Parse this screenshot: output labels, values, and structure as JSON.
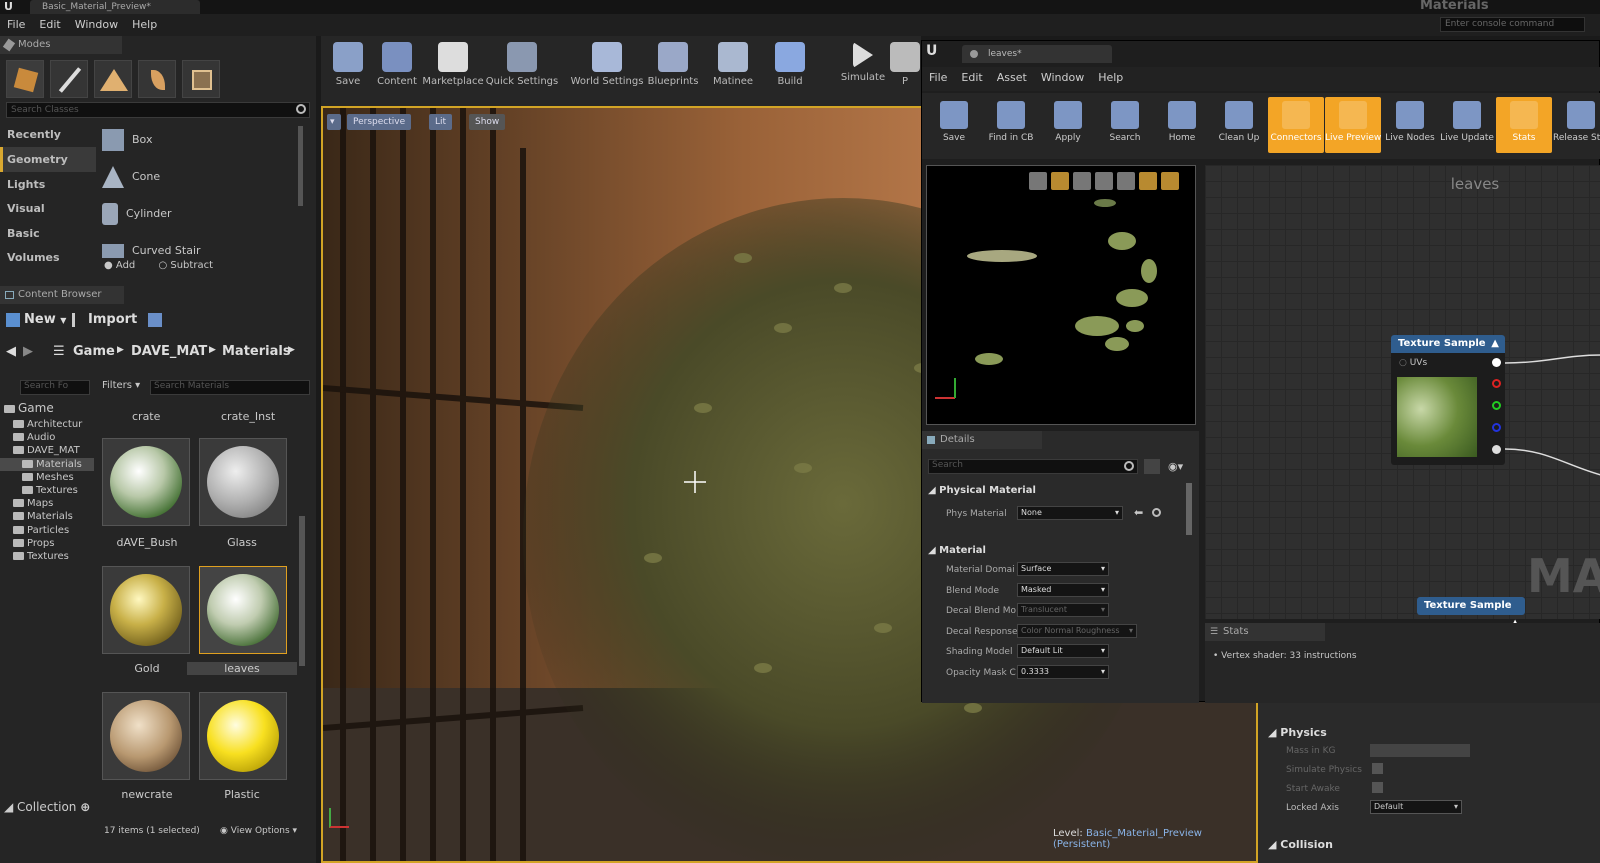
{
  "window": {
    "tab_title": "Basic_Material_Preview*",
    "app_title": "Materials",
    "console_placeholder": "Enter console command"
  },
  "menu": [
    "File",
    "Edit",
    "Window",
    "Help"
  ],
  "modes": {
    "tab": "Modes",
    "search_placeholder": "Search Classes",
    "categories": [
      "Recently Placed",
      "Geometry",
      "Lights",
      "Visual",
      "Basic",
      "Volumes"
    ],
    "shapes": [
      "Box",
      "Cone",
      "Cylinder",
      "Curved Stair"
    ],
    "brush": {
      "add": "Add",
      "subtract": "Subtract"
    }
  },
  "content_browser": {
    "tab": "Content Browser",
    "new_label": "New",
    "import_label": "Import",
    "breadcrumb": [
      "Game",
      "DAVE_MAT",
      "Materials"
    ],
    "folder_search_placeholder": "Search Fo",
    "filters_label": "Filters",
    "asset_search_placeholder": "Search Materials",
    "tree": [
      {
        "label": "Game",
        "level": 0
      },
      {
        "label": "Architectur",
        "level": 1
      },
      {
        "label": "Audio",
        "level": 1
      },
      {
        "label": "DAVE_MAT",
        "level": 1
      },
      {
        "label": "Materials",
        "level": 2
      },
      {
        "label": "Meshes",
        "level": 2
      },
      {
        "label": "Textures",
        "level": 2
      },
      {
        "label": "Maps",
        "level": 1
      },
      {
        "label": "Materials",
        "level": 1
      },
      {
        "label": "Particles",
        "level": 1
      },
      {
        "label": "Props",
        "level": 1
      },
      {
        "label": "Textures",
        "level": 1
      }
    ],
    "top_labels": [
      "crate",
      "crate_Inst"
    ],
    "assets": [
      "dAVE_Bush",
      "Glass",
      "Gold",
      "leaves",
      "newcrate",
      "Plastic"
    ],
    "collections_label": "Collection",
    "status": "17 items (1 selected)",
    "view_options": "View Options"
  },
  "toolbar": [
    "Save",
    "Content",
    "Marketplace",
    "Quick Settings",
    "World Settings",
    "Blueprints",
    "Matinee",
    "Build",
    "Simulate",
    "P"
  ],
  "viewport": {
    "perspective": "Perspective",
    "lit": "Lit",
    "show": "Show",
    "level_label": "Level:",
    "level_name": "Basic_Material_Preview (Persistent)"
  },
  "material_editor": {
    "tab": "leaves*",
    "menu": [
      "File",
      "Edit",
      "Asset",
      "Window",
      "Help"
    ],
    "toolbar": [
      {
        "label": "Save",
        "hl": false
      },
      {
        "label": "Find in CB",
        "hl": false
      },
      {
        "label": "Apply",
        "hl": false
      },
      {
        "label": "Search",
        "hl": false
      },
      {
        "label": "Home",
        "hl": false
      },
      {
        "label": "Clean Up",
        "hl": false
      },
      {
        "label": "Connectors",
        "hl": true
      },
      {
        "label": "Live Preview",
        "hl": true
      },
      {
        "label": "Live Nodes",
        "hl": false
      },
      {
        "label": "Live Update",
        "hl": false
      },
      {
        "label": "Stats",
        "hl": true
      },
      {
        "label": "Release Stats",
        "hl": false
      }
    ],
    "details": {
      "tab": "Details",
      "search_placeholder": "Search",
      "physical_section": "Physical Material",
      "phys_material_label": "Phys Material",
      "phys_material_value": "None",
      "material_section": "Material",
      "rows": [
        {
          "label": "Material Domai",
          "value": "Surface",
          "disabled": false
        },
        {
          "label": "Blend Mode",
          "value": "Masked",
          "disabled": false
        },
        {
          "label": "Decal Blend Mo",
          "value": "Translucent",
          "disabled": true
        },
        {
          "label": "Decal Response",
          "value": "Color Normal Roughness",
          "disabled": true
        },
        {
          "label": "Shading Model",
          "value": "Default Lit",
          "disabled": false
        },
        {
          "label": "Opacity Mask C",
          "value": "0.3333",
          "disabled": false
        }
      ]
    },
    "graph": {
      "title": "leaves",
      "node1": "Texture Sample",
      "node1_pin": "UVs",
      "node2": "Texture Sample",
      "watermark": "MAT"
    },
    "stats": {
      "tab": "Stats",
      "line": "Vertex shader: 33 instructions"
    }
  },
  "right_details": {
    "physics_section": "Physics",
    "rows": [
      "Mass in KG",
      "Simulate Physics",
      "Start Awake",
      "Locked Axis"
    ],
    "locked_axis_value": "Default",
    "collision_section": "Collision"
  }
}
